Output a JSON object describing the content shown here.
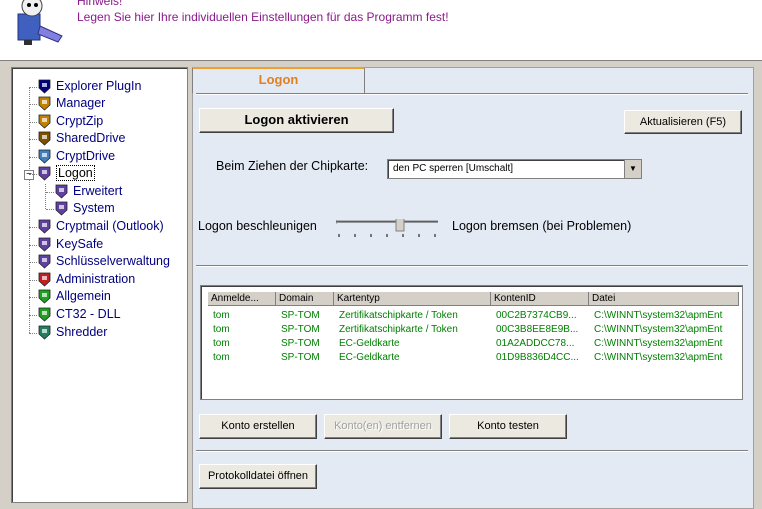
{
  "header": {
    "hint_title": "Hinweis!",
    "hint_text": "Legen Sie hier Ihre individuellen Einstellungen für das Programm fest!"
  },
  "tree": {
    "items": [
      {
        "label": "Explorer PlugIn",
        "icon": "explorer-plugin-icon",
        "color": "#000080"
      },
      {
        "label": "Manager",
        "icon": "manager-icon",
        "color": "#c08000"
      },
      {
        "label": "CryptZip",
        "icon": "cryptzip-icon",
        "color": "#c08000"
      },
      {
        "label": "SharedDrive",
        "icon": "shareddrive-icon",
        "color": "#805000"
      },
      {
        "label": "CryptDrive",
        "icon": "cryptdrive-icon",
        "color": "#4080c0"
      },
      {
        "label": "Logon",
        "icon": "logon-icon",
        "color": "#6040a0"
      },
      {
        "label": "Erweitert",
        "icon": "erweitert-icon",
        "color": "#6040a0"
      },
      {
        "label": "System",
        "icon": "system-icon",
        "color": "#6040a0"
      },
      {
        "label": "Cryptmail (Outlook)",
        "icon": "cryptmail-icon",
        "color": "#6040a0"
      },
      {
        "label": "KeySafe",
        "icon": "keysafe-icon",
        "color": "#6040a0"
      },
      {
        "label": "Schlüsselverwaltung",
        "icon": "schluesselverwaltung-icon",
        "color": "#6040a0"
      },
      {
        "label": "Administration",
        "icon": "administration-icon",
        "color": "#c02020"
      },
      {
        "label": "Allgemein",
        "icon": "allgemein-icon",
        "color": "#20a020"
      },
      {
        "label": "CT32 - DLL",
        "icon": "ct32-dll-icon",
        "color": "#20a020"
      },
      {
        "label": "Shredder",
        "icon": "shredder-icon",
        "color": "#208060"
      }
    ],
    "selected": "Logon"
  },
  "tabs": [
    {
      "label": "Logon"
    }
  ],
  "buttons": {
    "logon_activate": "Logon aktivieren",
    "refresh": "Aktualisieren (F5)",
    "create_account": "Konto erstellen",
    "remove_account": "Konto(en) entfernen",
    "test_account": "Konto testen",
    "open_log": "Protokolldatei öffnen"
  },
  "chipcard": {
    "label": "Beim Ziehen der Chipkarte:",
    "selected_option": "den PC sperren [Umschalt]"
  },
  "speed": {
    "left_label": "Logon beschleunigen",
    "right_label": "Logon bremsen (bei Problemen)"
  },
  "accounts_table": {
    "columns": [
      "Anmelde...",
      "Domain",
      "Kartentyp",
      "KontenID",
      "Datei"
    ],
    "rows": [
      [
        "tom",
        "SP-TOM",
        "Zertifikatschipkarte / Token",
        "00C2B7374CB9...",
        "C:\\WINNT\\system32\\apmEnt"
      ],
      [
        "tom",
        "SP-TOM",
        "Zertifikatschipkarte / Token",
        "00C3B8EE8E9B...",
        "C:\\WINNT\\system32\\apmEnt"
      ],
      [
        "tom",
        "SP-TOM",
        "EC-Geldkarte",
        "01A2ADDCC78...",
        "C:\\WINNT\\system32\\apmEnt"
      ],
      [
        "tom",
        "SP-TOM",
        "EC-Geldkarte",
        "01D9B836D4CC...",
        "C:\\WINNT\\system32\\apmEnt"
      ]
    ],
    "row_color": "#008000"
  },
  "colors": {
    "accent_tab": "#e08020",
    "hint_text": "#8b1a8b",
    "panel_bg": "#e4eaf3"
  }
}
